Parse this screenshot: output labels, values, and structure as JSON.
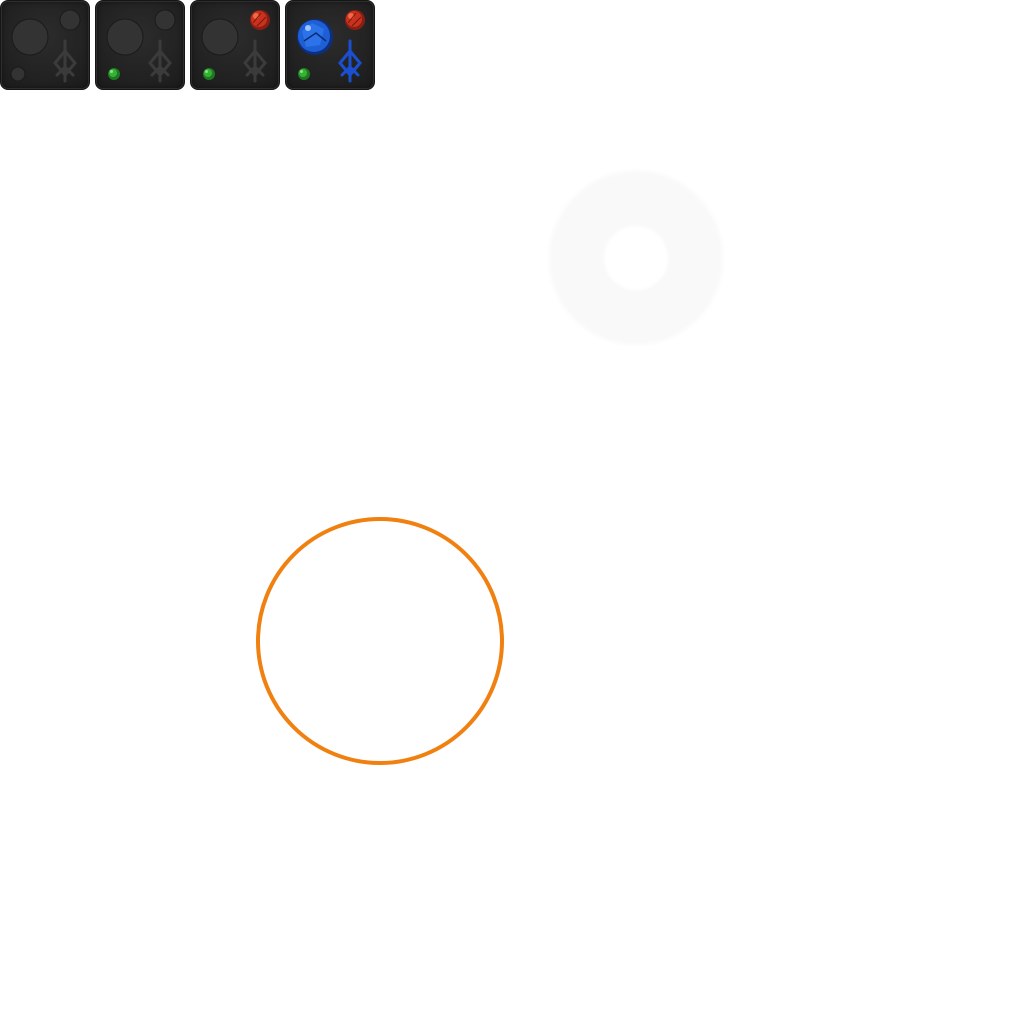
{
  "tiles": [
    {
      "id": "tile-1",
      "socket_large": "empty",
      "socket_top_right": "empty",
      "socket_bottom_left": "empty",
      "rune_lit": false
    },
    {
      "id": "tile-2",
      "socket_large": "empty",
      "socket_top_right": "empty",
      "socket_bottom_left": "green-gem",
      "rune_lit": false
    },
    {
      "id": "tile-3",
      "socket_large": "empty",
      "socket_top_right": "red-gem",
      "socket_bottom_left": "green-gem",
      "rune_lit": false
    },
    {
      "id": "tile-4",
      "socket_large": "blue-gem",
      "socket_top_right": "red-gem",
      "socket_bottom_left": "green-gem",
      "rune_lit": true
    }
  ],
  "colors": {
    "tile_background": "#222222",
    "empty_socket": "#333333",
    "rune_dim": "#3a3a3a",
    "rune_lit": "#1a4fd0",
    "blue_gem": "#1f5fd6",
    "red_gem": "#c8321e",
    "green_gem": "#2aa02a",
    "accent_ring": "#f08010",
    "faint_ring": "#f9f9f9"
  }
}
